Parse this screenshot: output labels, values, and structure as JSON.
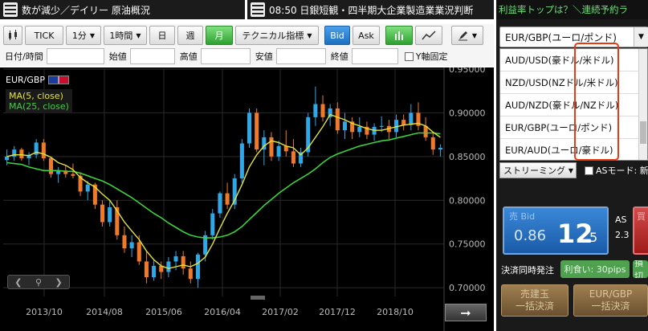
{
  "ticker": {
    "news1": "数が減少／デイリー 原油概況",
    "news2": "08:50 日銀短観・四半期大企業製造業業況判断",
    "news3": "利益率トップは？＼連続予約ラ"
  },
  "toolbar": {
    "tick": "TICK",
    "interval_minutes": "1分",
    "interval_hour": "1時間",
    "day": "日",
    "week": "週",
    "month": "月",
    "technical": "テクニカル指標",
    "bid": "Bid",
    "ask": "Ask"
  },
  "fields": {
    "datetime": "日付/時間",
    "open": "始値",
    "high": "高値",
    "low": "安値",
    "close": "終値",
    "y_fixed": "Y軸固定"
  },
  "chart": {
    "pair": "EUR/GBP",
    "ma5": "MA(5, close)",
    "ma25": "MA(25, close)",
    "colors": {
      "up": "#2fa8e8",
      "down": "#f07a28",
      "ma5": "#e4e43a",
      "ma25": "#3cd33c",
      "bg": "#000000"
    }
  },
  "chart_data": {
    "type": "candlestick",
    "ylim": [
      0.69,
      0.95
    ],
    "y_ticks": [
      "0.95000",
      "0.90000",
      "0.85000",
      "0.80000",
      "0.75000",
      "0.70000"
    ],
    "y_tick_values": [
      0.95,
      0.9,
      0.85,
      0.8,
      0.75,
      0.7
    ],
    "x_ticks": [
      "2013/10",
      "2014/08",
      "2015/06",
      "2016/04",
      "2017/02",
      "2017/12",
      "2018/10"
    ],
    "candles": [
      [
        0.846,
        0.858,
        0.84,
        0.85
      ],
      [
        0.85,
        0.862,
        0.845,
        0.858
      ],
      [
        0.858,
        0.86,
        0.845,
        0.848
      ],
      [
        0.848,
        0.855,
        0.84,
        0.852
      ],
      [
        0.852,
        0.87,
        0.848,
        0.866
      ],
      [
        0.866,
        0.87,
        0.845,
        0.848
      ],
      [
        0.848,
        0.85,
        0.826,
        0.83
      ],
      [
        0.83,
        0.838,
        0.82,
        0.834
      ],
      [
        0.834,
        0.84,
        0.826,
        0.83
      ],
      [
        0.83,
        0.842,
        0.825,
        0.828
      ],
      [
        0.828,
        0.832,
        0.805,
        0.81
      ],
      [
        0.81,
        0.822,
        0.8,
        0.818
      ],
      [
        0.818,
        0.82,
        0.79,
        0.795
      ],
      [
        0.795,
        0.8,
        0.77,
        0.775
      ],
      [
        0.775,
        0.8,
        0.77,
        0.792
      ],
      [
        0.792,
        0.8,
        0.755,
        0.76
      ],
      [
        0.76,
        0.77,
        0.74,
        0.745
      ],
      [
        0.745,
        0.76,
        0.735,
        0.752
      ],
      [
        0.752,
        0.76,
        0.726,
        0.73
      ],
      [
        0.73,
        0.742,
        0.705,
        0.712
      ],
      [
        0.712,
        0.732,
        0.708,
        0.725
      ],
      [
        0.725,
        0.73,
        0.71,
        0.718
      ],
      [
        0.718,
        0.735,
        0.712,
        0.73
      ],
      [
        0.73,
        0.742,
        0.72,
        0.736
      ],
      [
        0.736,
        0.742,
        0.715,
        0.722
      ],
      [
        0.722,
        0.73,
        0.705,
        0.71
      ],
      [
        0.71,
        0.74,
        0.7,
        0.738
      ],
      [
        0.738,
        0.765,
        0.73,
        0.76
      ],
      [
        0.76,
        0.79,
        0.755,
        0.785
      ],
      [
        0.785,
        0.81,
        0.78,
        0.808
      ],
      [
        0.808,
        0.82,
        0.79,
        0.795
      ],
      [
        0.795,
        0.83,
        0.79,
        0.825
      ],
      [
        0.825,
        0.87,
        0.82,
        0.865
      ],
      [
        0.865,
        0.905,
        0.86,
        0.9
      ],
      [
        0.9,
        0.905,
        0.855,
        0.858
      ],
      [
        0.858,
        0.88,
        0.84,
        0.872
      ],
      [
        0.872,
        0.878,
        0.845,
        0.85
      ],
      [
        0.85,
        0.868,
        0.845,
        0.862
      ],
      [
        0.862,
        0.88,
        0.85,
        0.856
      ],
      [
        0.856,
        0.87,
        0.838,
        0.842
      ],
      [
        0.842,
        0.86,
        0.838,
        0.855
      ],
      [
        0.855,
        0.9,
        0.85,
        0.895
      ],
      [
        0.895,
        0.93,
        0.885,
        0.91
      ],
      [
        0.91,
        0.92,
        0.89,
        0.895
      ],
      [
        0.895,
        0.91,
        0.885,
        0.905
      ],
      [
        0.905,
        0.912,
        0.876,
        0.88
      ],
      [
        0.88,
        0.9,
        0.87,
        0.89
      ],
      [
        0.89,
        0.895,
        0.87,
        0.878
      ],
      [
        0.878,
        0.895,
        0.872,
        0.884
      ],
      [
        0.884,
        0.89,
        0.87,
        0.875
      ],
      [
        0.875,
        0.888,
        0.868,
        0.884
      ],
      [
        0.884,
        0.896,
        0.878,
        0.885
      ],
      [
        0.885,
        0.892,
        0.87,
        0.878
      ],
      [
        0.878,
        0.898,
        0.872,
        0.892
      ],
      [
        0.892,
        0.898,
        0.88,
        0.886
      ],
      [
        0.886,
        0.91,
        0.88,
        0.9
      ],
      [
        0.9,
        0.912,
        0.88,
        0.885
      ],
      [
        0.885,
        0.895,
        0.868,
        0.872
      ],
      [
        0.872,
        0.878,
        0.852,
        0.858
      ],
      [
        0.858,
        0.864,
        0.85,
        0.86
      ]
    ],
    "ma5": [
      0.85,
      0.852,
      0.852,
      0.851,
      0.855,
      0.853,
      0.849,
      0.843,
      0.84,
      0.835,
      0.826,
      0.82,
      0.815,
      0.807,
      0.8,
      0.788,
      0.775,
      0.765,
      0.755,
      0.742,
      0.732,
      0.725,
      0.722,
      0.724,
      0.726,
      0.724,
      0.728,
      0.735,
      0.75,
      0.768,
      0.785,
      0.8,
      0.818,
      0.838,
      0.852,
      0.862,
      0.868,
      0.866,
      0.862,
      0.86,
      0.852,
      0.86,
      0.872,
      0.884,
      0.898,
      0.895,
      0.892,
      0.888,
      0.885,
      0.882,
      0.88,
      0.88,
      0.882,
      0.884,
      0.886,
      0.887,
      0.888,
      0.885,
      0.878,
      0.872
    ],
    "ma25": [
      0.843,
      0.842,
      0.841,
      0.838,
      0.836,
      0.834,
      0.834,
      0.834,
      0.833,
      0.833,
      0.831,
      0.828,
      0.825,
      0.822,
      0.818,
      0.813,
      0.808,
      0.803,
      0.797,
      0.791,
      0.785,
      0.78,
      0.774,
      0.769,
      0.764,
      0.76,
      0.758,
      0.757,
      0.757,
      0.758,
      0.76,
      0.764,
      0.77,
      0.778,
      0.786,
      0.794,
      0.801,
      0.808,
      0.814,
      0.82,
      0.825,
      0.83,
      0.836,
      0.843,
      0.849,
      0.853,
      0.856,
      0.859,
      0.862,
      0.864,
      0.866,
      0.868,
      0.869,
      0.871,
      0.873,
      0.875,
      0.877,
      0.877,
      0.877,
      0.876
    ]
  },
  "right_panel": {
    "selected_pair": "EUR/GBP(ユーロ/ポンド)",
    "pair_options": [
      "AUD/USD(豪ドル/米ドル)",
      "NZD/USD(NZドル/米ドル)",
      "AUD/NZD(豪ドル/NZドル)",
      "EUR/GBP(ユーロ/ポンド)",
      "EUR/AUD(ユーロ/豪ドル)"
    ],
    "streaming": "ストリーミング",
    "as_mode": "ASモード: 新",
    "bid_label": "売 Bid",
    "bid_prefix": "0.86",
    "bid_big": "12",
    "bid_small": "5",
    "as_label": "AS",
    "spread": "2.3",
    "ask_label": "買",
    "settlement": "決済同時発注",
    "take_profit": "利食い: 30pips",
    "stop_loss": "損切",
    "btn_bulk_settle_label": "売建玉",
    "btn_bulk_settle_sub": "一括決済",
    "btn_pair_settle_label": "EUR/GBP",
    "btn_pair_settle_sub": "一括決済"
  }
}
